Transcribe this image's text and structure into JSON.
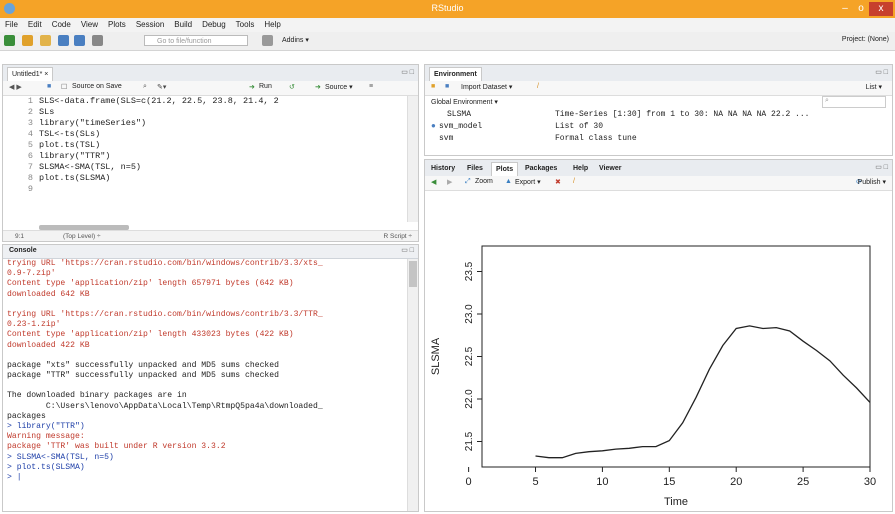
{
  "window": {
    "title": "RStudio",
    "min": "–",
    "max": "o",
    "close": "x"
  },
  "menu": [
    "File",
    "Edit",
    "Code",
    "View",
    "Plots",
    "Session",
    "Build",
    "Debug",
    "Tools",
    "Help"
  ],
  "toolbar": {
    "goto_placeholder": "Go to file/function",
    "addins": "Addins ▾",
    "project": "Project: (None)"
  },
  "source": {
    "tab": "Untitled1* ×",
    "source_on_save": "Source on Save",
    "run": "Run",
    "source_btn": "Source ▾",
    "lines": [
      {
        "n": "1",
        "t": "SLS<-data.frame(SLS=c(21.2, 22.5, 23.8, 21.4, 2"
      },
      {
        "n": "2",
        "t": "SLs"
      },
      {
        "n": "3",
        "t": "library(\"timeSeries\")"
      },
      {
        "n": "4",
        "t": "TSL<-ts(SLs)"
      },
      {
        "n": "5",
        "t": "plot.ts(TSL)"
      },
      {
        "n": "6",
        "t": "library(\"TTR\")"
      },
      {
        "n": "7",
        "t": "SLSMA<-SMA(TSL, n=5)"
      },
      {
        "n": "8",
        "t": "plot.ts(SLSMA)"
      },
      {
        "n": "9",
        "t": ""
      }
    ],
    "status_pos": "9:1",
    "status_level": "(Top Level) ÷",
    "status_type": "R Script ÷"
  },
  "console": {
    "tab": "Console",
    "lines": [
      {
        "c": "red",
        "t": "trying URL 'https://cran.rstudio.com/bin/windows/contrib/3.3/xts_"
      },
      {
        "c": "red",
        "t": "0.9-7.zip'"
      },
      {
        "c": "red",
        "t": "Content type 'application/zip' length 657971 bytes (642 KB)"
      },
      {
        "c": "red",
        "t": "downloaded 642 KB"
      },
      {
        "c": "red",
        "t": ""
      },
      {
        "c": "red",
        "t": "trying URL 'https://cran.rstudio.com/bin/windows/contrib/3.3/TTR_"
      },
      {
        "c": "red",
        "t": "0.23-1.zip'"
      },
      {
        "c": "red",
        "t": "Content type 'application/zip' length 433023 bytes (422 KB)"
      },
      {
        "c": "red",
        "t": "downloaded 422 KB"
      },
      {
        "c": "black",
        "t": ""
      },
      {
        "c": "black",
        "t": "package \"xts\" successfully unpacked and MD5 sums checked"
      },
      {
        "c": "black",
        "t": "package \"TTR\" successfully unpacked and MD5 sums checked"
      },
      {
        "c": "black",
        "t": ""
      },
      {
        "c": "black",
        "t": "The downloaded binary packages are in"
      },
      {
        "c": "black",
        "t": "        C:\\Users\\lenovo\\AppData\\Local\\Temp\\RtmpQ5pa4a\\downloaded_"
      },
      {
        "c": "black",
        "t": "packages"
      },
      {
        "c": "blue",
        "t": "> library(\"TTR\")"
      },
      {
        "c": "red",
        "t": "Warning message:"
      },
      {
        "c": "red",
        "t": "package 'TTR' was built under R version 3.3.2"
      },
      {
        "c": "blue",
        "t": "> SLSMA<-SMA(TSL, n=5)"
      },
      {
        "c": "blue",
        "t": "> plot.ts(SLSMA)"
      },
      {
        "c": "blue",
        "t": "> |"
      }
    ]
  },
  "environment": {
    "tab": "Environment",
    "import": "Import Dataset ▾",
    "list": "List ▾",
    "scope": "Global Environment ▾",
    "rows": [
      {
        "name": "SLSMA",
        "value": "Time-Series [1:30] from 1 to 30: NA NA NA NA 22.2 ..."
      },
      {
        "name": "svm_model",
        "value": "List of 30"
      },
      {
        "name": "svm",
        "value": "Formal class tune"
      }
    ]
  },
  "viewer": {
    "tabs": [
      "History",
      "Files",
      "Plots",
      "Packages",
      "Help",
      "Viewer"
    ],
    "zoom": "Zoom",
    "export": "Export ▾",
    "publish": "Publish ▾"
  },
  "chart_data": {
    "type": "line",
    "xlabel": "Time",
    "ylabel": "SLSMA",
    "xlim": [
      1,
      30
    ],
    "ylim": [
      21.2,
      23.8
    ],
    "xticks": [
      0,
      5,
      10,
      15,
      20,
      25,
      30
    ],
    "yticks": [
      21.5,
      22.0,
      22.5,
      23.0,
      23.5
    ],
    "grid": false,
    "x": [
      5,
      6,
      7,
      8,
      9,
      10,
      11,
      12,
      13,
      14,
      15,
      16,
      17,
      18,
      19,
      20,
      21,
      22,
      23,
      24,
      25,
      26,
      27,
      28,
      29,
      30
    ],
    "y": [
      21.33,
      21.31,
      21.31,
      21.36,
      21.38,
      21.39,
      21.41,
      21.42,
      21.44,
      21.44,
      21.51,
      21.72,
      22.02,
      22.35,
      22.63,
      22.83,
      22.86,
      22.83,
      22.84,
      22.8,
      22.68,
      22.57,
      22.45,
      22.28,
      22.13,
      21.96
    ]
  }
}
